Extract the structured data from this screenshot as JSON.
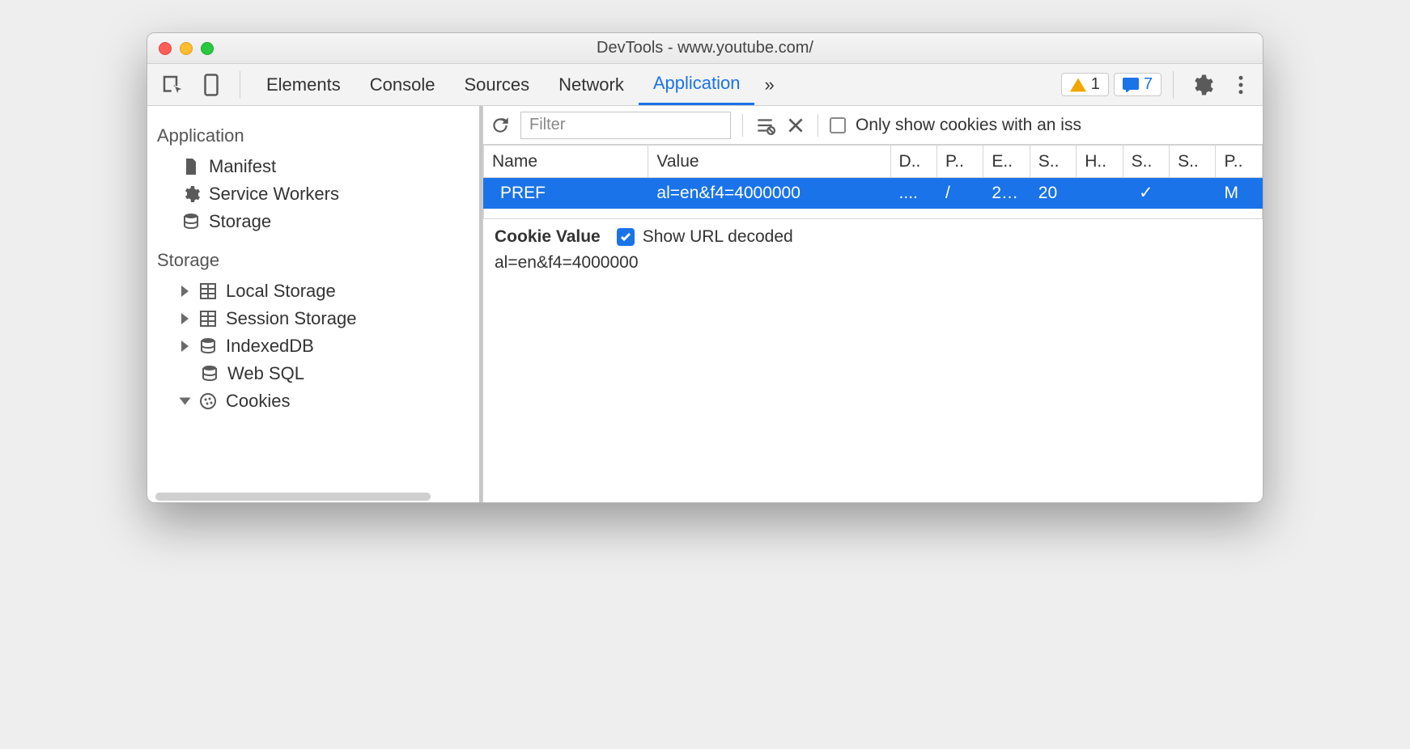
{
  "window": {
    "title": "DevTools - www.youtube.com/"
  },
  "toolbar": {
    "tabs": [
      "Elements",
      "Console",
      "Sources",
      "Network",
      "Application"
    ],
    "active_tab": "Application",
    "more_glyph": "»",
    "warnings_count": "1",
    "messages_count": "7"
  },
  "sidebar": {
    "section1_title": "Application",
    "items1": [
      {
        "label": "Manifest"
      },
      {
        "label": "Service Workers"
      },
      {
        "label": "Storage"
      }
    ],
    "section2_title": "Storage",
    "items2": [
      {
        "label": "Local Storage"
      },
      {
        "label": "Session Storage"
      },
      {
        "label": "IndexedDB"
      },
      {
        "label": "Web SQL"
      },
      {
        "label": "Cookies"
      }
    ]
  },
  "content": {
    "filter_placeholder": "Filter",
    "only_issues_label": "Only show cookies with an iss",
    "columns": [
      "Name",
      "Value",
      "D..",
      "P..",
      "E..",
      "S..",
      "H..",
      "S..",
      "S..",
      "P.."
    ],
    "row": {
      "name": "PREF",
      "value": "al=en&f4=4000000",
      "domain": "....",
      "path": "/",
      "expires": "2…",
      "size": "20",
      "httponly": "",
      "secure": "✓",
      "samesite": "",
      "priority": "M"
    },
    "detail": {
      "title": "Cookie Value",
      "decode_label": "Show URL decoded",
      "value": "al=en&f4=4000000"
    }
  }
}
